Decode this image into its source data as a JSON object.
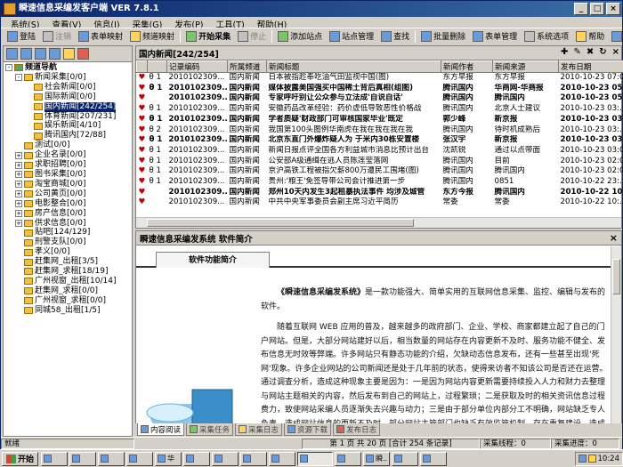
{
  "window": {
    "title": "瞬速信息采编发客户端 VER 7.8.1"
  },
  "menu": [
    "系统(S)",
    "查看(V)",
    "信息(I)",
    "采集(G)",
    "发布(P)",
    "工具(T)",
    "帮助(H)"
  ],
  "toolbar": {
    "login": "登陆",
    "logout": "注销",
    "table_map": "表单映射",
    "channel_map": "频道映射",
    "start": "开始采集",
    "stop": "停止",
    "add_site": "添加站点",
    "site_mgmt": "站点管理",
    "find": "查找",
    "batch_delete": "批量删除",
    "form_mgmt": "表单管理",
    "sys_options": "系统选项",
    "help": "帮助",
    "exit": "退出",
    "page_value": "1"
  },
  "tree": [
    {
      "label": "频道导航",
      "level": 0,
      "type": "root",
      "bold": true
    },
    {
      "label": "新闻采集[0/0]",
      "level": 1,
      "box": "-"
    },
    {
      "label": "社会新闻[0/0]",
      "level": 2
    },
    {
      "label": "国际新闻[0/0]",
      "level": 2
    },
    {
      "label": "国内新闻[242/254]",
      "level": 2,
      "selected": true
    },
    {
      "label": "体育新闻[207/231]",
      "level": 2
    },
    {
      "label": "娱乐新闻[4/10]",
      "level": 2
    },
    {
      "label": "腾讯国内[72/88]",
      "level": 2
    },
    {
      "label": "测试[0/0]",
      "level": 1
    },
    {
      "label": "企业名录[0/0]",
      "level": 1,
      "box": "+"
    },
    {
      "label": "求职招聘[0/0]",
      "level": 1,
      "box": "+"
    },
    {
      "label": "图书采集[0/0]",
      "level": 1,
      "box": "+"
    },
    {
      "label": "淘宝商城[0/0]",
      "level": 1,
      "box": "+"
    },
    {
      "label": "公司黄页[0/0]",
      "level": 1,
      "box": "+"
    },
    {
      "label": "电影整合[0/0]",
      "level": 1,
      "box": "+"
    },
    {
      "label": "房产信息[0/0]",
      "level": 1,
      "box": "+"
    },
    {
      "label": "供求信息[0/0]",
      "level": 1,
      "box": "+"
    },
    {
      "label": "贴吧[124/129]",
      "level": 1
    },
    {
      "label": "刑警支队[0/0]",
      "level": 1
    },
    {
      "label": "孝义[0/0]",
      "level": 1
    },
    {
      "label": "赶集网_出租[3/5]",
      "level": 1
    },
    {
      "label": "赶集网_求租[18/19]",
      "level": 1
    },
    {
      "label": "广州视窗_出租[10/14]",
      "level": 1
    },
    {
      "label": "赶集网_求租[0/0]",
      "level": 1
    },
    {
      "label": "广州视窗_求租[0/0]",
      "level": 1
    },
    {
      "label": "同城58_出租[1/5]",
      "level": 1
    }
  ],
  "list": {
    "header_title": "国内新闻[242/254]",
    "columns": [
      "",
      "",
      "记录编码",
      "所属频道",
      "新闻标题",
      "新闻作者",
      "新闻来源",
      "发布日期"
    ],
    "rows": [
      {
        "c1": "♥",
        "c2": "θ 1",
        "code": "2010102309...",
        "ch": "国内新闻",
        "title": "日本被指趁奉吃油气田监视中国(图)",
        "author": "东方早报",
        "source": "东方早报",
        "date": "2010-10-23 07:0..."
      },
      {
        "c1": "♥",
        "c2": "θ 1",
        "code": "2010102309...",
        "ch": "国内新闻",
        "title": "媒体披露美国强买中国稀土背后真相(组图)",
        "author": "腾讯国内",
        "source": "华商网-华商报",
        "date": "2010-10-23 05:...",
        "bold": true
      },
      {
        "c1": "♥",
        "c2": "",
        "code": "2010102309...",
        "ch": "国内新闻",
        "title": "专家呼吁别让公众参与立法成'自说自话'",
        "author": "腾讯国内",
        "source": "腾讯国内",
        "date": "2010-10-23 05:...",
        "bold": true
      },
      {
        "c1": "♥",
        "c2": "θ 1",
        "code": "2010102309...",
        "ch": "国内新闻",
        "title": "安徽药品改革经验：药价虚低导致恶性价格战",
        "author": "腾讯国内",
        "source": "北京人士建议",
        "date": "2010-10-23 03:..."
      },
      {
        "c1": "♥",
        "c2": "θ 1",
        "code": "2010102309...",
        "ch": "国内新闻",
        "title": "学者质疑'财政部门可审核国家毕业'既定",
        "author": "郭少峰",
        "source": "新京报",
        "date": "2010-10-23 03:...",
        "bold": true
      },
      {
        "c1": "♥",
        "c2": "θ 2",
        "code": "2010102309...",
        "ch": "国内新闻",
        "title": "我国第100头图例华南虎在我在我在我在我",
        "author": "腾讯国内",
        "source": "待时机成熟后",
        "date": "2010-10-23 03:..."
      },
      {
        "c1": "♥",
        "c2": "θ 1",
        "code": "2010102309...",
        "ch": "国内新闻",
        "title": "北京东直门外爆炸疑人为 于米内30栋安置楼",
        "author": "张汉宇",
        "source": "新京报",
        "date": "2010-10-23 03:...",
        "bold": true
      },
      {
        "c1": "♥",
        "c2": "θ 1",
        "code": "2010102309...",
        "ch": "国内新闻",
        "title": "新闻日报点评全国各方利益城市消息比预计出台",
        "author": "沈凯锐",
        "source": "通过以点带面",
        "date": "2010-10-23 03:0..."
      },
      {
        "c1": "♥",
        "c2": "θ 1",
        "code": "2010102309...",
        "ch": "国内新闻",
        "title": "公安部A级通缉在逃人员陈莲莹落网",
        "author": "腾讯国内",
        "source": "目前",
        "date": "2010-10-23 02:0..."
      },
      {
        "c1": "♥",
        "c2": "θ 1",
        "code": "2010102309...",
        "ch": "国内新闻",
        "title": "京沪高铁工程被指欠薪800万遭民工围堵(图)",
        "author": "腾讯国内",
        "source": "腾讯国内",
        "date": "2010-10-23 02:0..."
      },
      {
        "c1": "♥",
        "c2": "θ 1",
        "code": "2010102309...",
        "ch": "国内新闻",
        "title": "贵州:'粮王'免签导带公司会计推进第一步",
        "author": "腾讯国内",
        "source": "0851",
        "date": "2010-10-22 23:..."
      },
      {
        "c1": "♥",
        "c2": "",
        "code": "2010102309...",
        "ch": "国内新闻",
        "title": "郑州10天内发生3起租暴执法事件 均涉及城管",
        "author": "东方今报",
        "source": "腾讯国内",
        "date": "2010-10-22 10:...",
        "bold": true
      },
      {
        "c1": "♥",
        "c2": "",
        "code": "2010102309...",
        "ch": "国内新闻",
        "title": "中共中央军事委员会副主席习近平简历",
        "author": "常委",
        "source": "常委",
        "date": "2010-10-22 10:..."
      }
    ]
  },
  "preview": {
    "title": "瞬速信息采编发系统 软件简介",
    "tab": "软件功能简介",
    "p1_bold": "《瞬速信息采编发系统》",
    "p1_rest": "是一款功能强大、简单实用的互联网信息采集、监控、编辑与发布的软件。",
    "p2": "随着互联网 WEB 应用的普及，越来越多的政府部门、企业、学校、商家都建立起了自己的门户网站。但是，大部分网站建好以后，相当数量的网站存在内容更新不及时、服务功能不健全、发布信息无时效等弊端。许多网站只有静态功能的介绍，欠缺动态信息发布，还有一些甚至出现'死网'现象。许多企业网站的公司新闻还是处于几年前的状态，使得来访者不知该公司是否还在运营。通过调查分析，造成这种现象主要是因为：一是因为网站内容更新需要持续投入人力和财力去整理与网站主题相关的内容，然后发布到自己的网站上，过程繁琐；二是获取及时的相关资讯信息过程费力，致使网站采编人员逐渐失去兴趣与动力；三是由于部分单位内部分工不明确，网站缺乏专人负责，造成网站信息的更新不及时，部分网站主管部门也缺乏有效监管机制，存在重复建设、造成资源浪费。长此以往"
  },
  "bottom_tabs": [
    "内容阅读",
    "采集任务",
    "采集日志",
    "资源下载",
    "发布日志"
  ],
  "status": {
    "ready": "就绪",
    "page": "第 1 页 共 20 页 [合计 254 条记录]",
    "threads_label": "采集线程：",
    "threads": "0",
    "progress_label": "采集进度：",
    "progress": "0"
  },
  "taskbar": {
    "start": "开始",
    "tasks": [
      "",
      "",
      "",
      "",
      "华",
      "",
      "",
      "",
      "",
      "",
      "",
      "瞬..",
      "",
      ""
    ],
    "clock": "10:24"
  }
}
